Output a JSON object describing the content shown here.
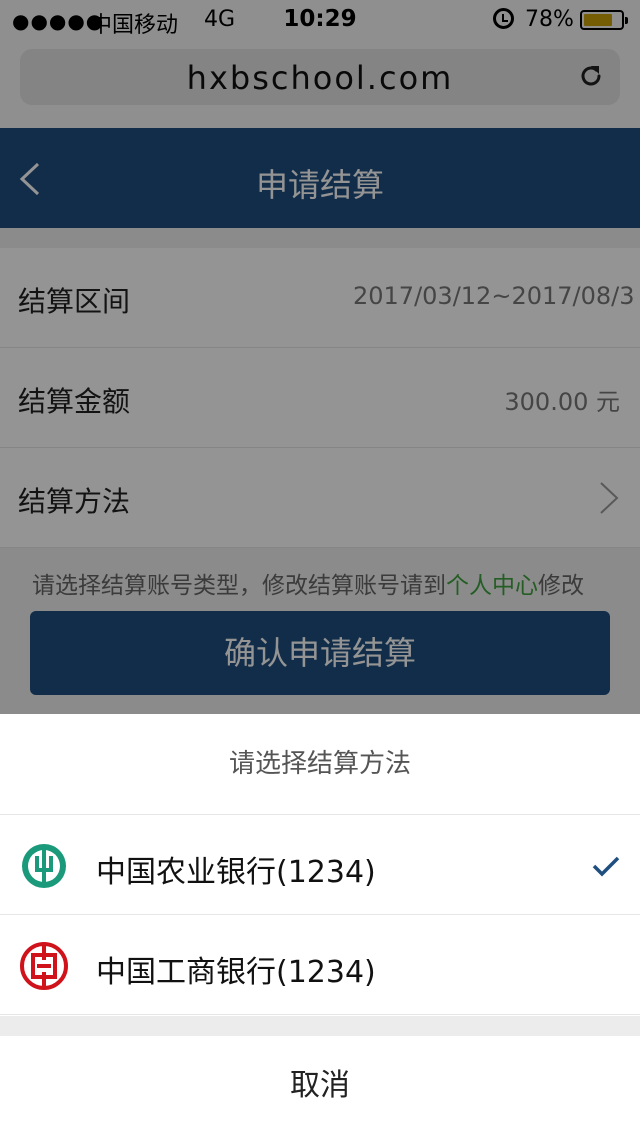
{
  "status_bar": {
    "signal": "●●●●●",
    "carrier": "中国移动",
    "network": "4G",
    "time": "10:29",
    "battery": "78%",
    "battery_level": 0.78,
    "battery_color": "#caa10c"
  },
  "browser": {
    "url": "hxbschool.com",
    "reload_icon": "reload-icon"
  },
  "nav": {
    "back_icon": "chevron-left-icon",
    "title": "申请结算",
    "bar_color": "#1f4f7f"
  },
  "form": {
    "period": {
      "label": "结算区间",
      "value": "2017/03/12~2017/08/3"
    },
    "amount": {
      "label": "结算金额",
      "value": "300.00 元"
    },
    "method": {
      "label": "结算方法"
    }
  },
  "hint": {
    "prefix": "请选择结算账号类型，修改结算账号请到",
    "link": "个人中心",
    "suffix": "修改",
    "link_color": "#3fa23f"
  },
  "confirm_button": "确认申请结算",
  "sheet": {
    "title": "请选择结算方法",
    "options": [
      {
        "label": "中国农业银行(1234)",
        "icon": "abc-bank-logo",
        "selected": true
      },
      {
        "label": "中国工商银行(1234)",
        "icon": "icbc-bank-logo",
        "selected": false
      }
    ],
    "cancel": "取消"
  }
}
